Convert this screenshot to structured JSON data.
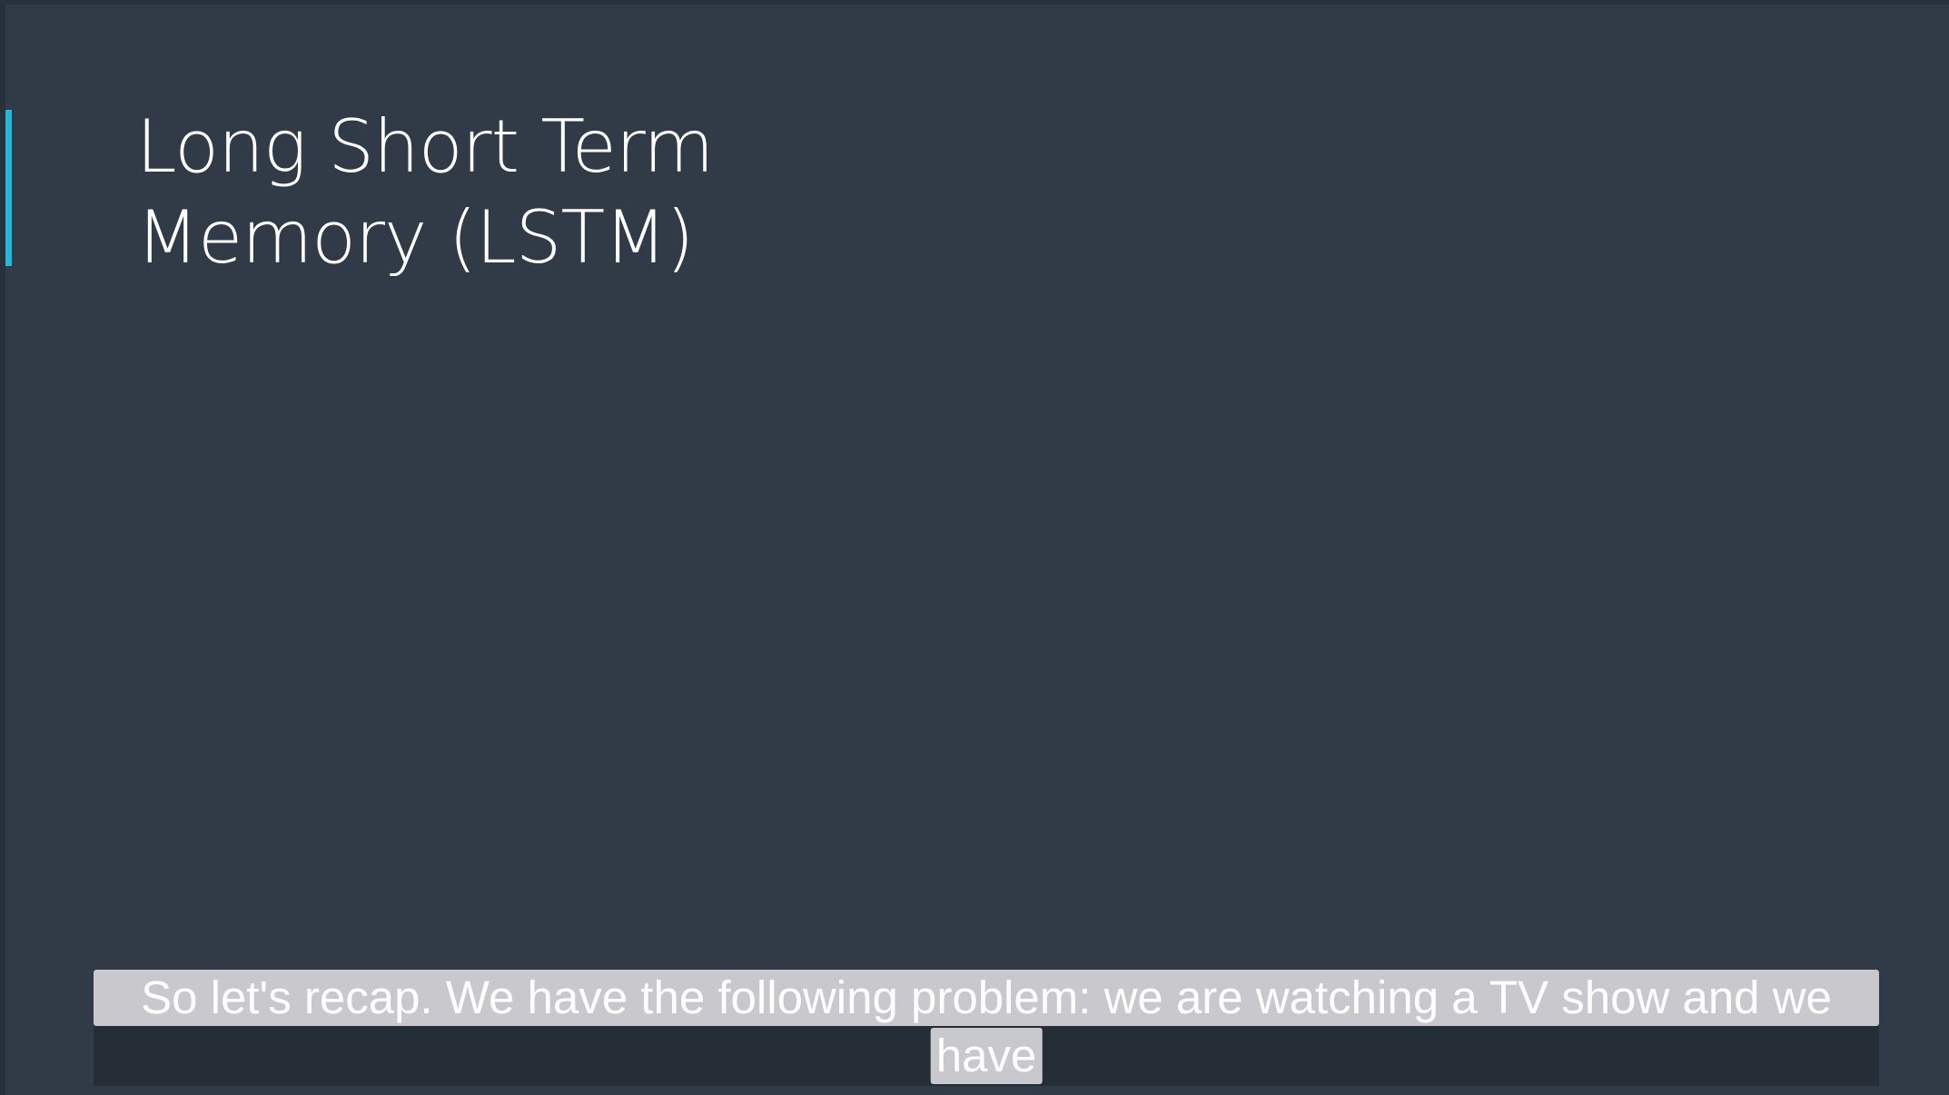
{
  "slide": {
    "title_line_1": "Long Short Term",
    "title_line_2": "Memory (LSTM)",
    "accent_color": "#27b8d8",
    "background_color": "#303b47"
  },
  "captions": {
    "line_1": "So let's recap. We have the following problem: we are watching a TV show and we",
    "line_2": "have"
  }
}
